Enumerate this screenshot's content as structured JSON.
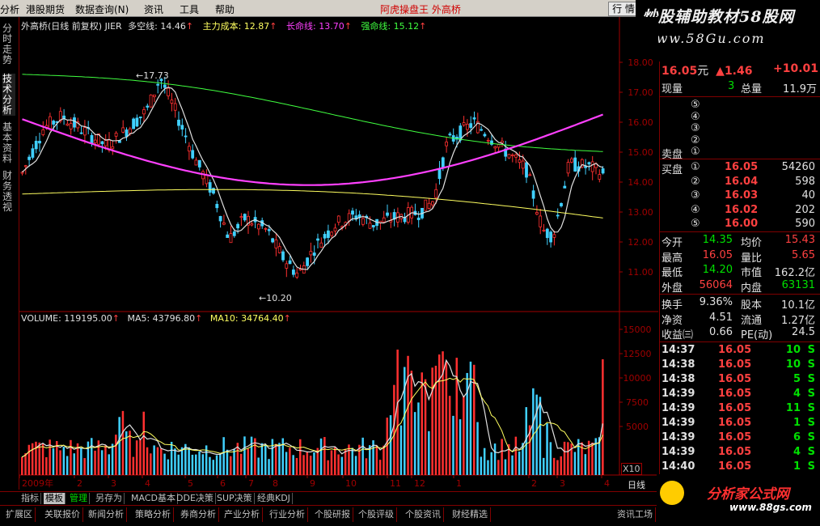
{
  "menu": {
    "items": [
      "分析",
      "港股期货",
      "数据查询(N)",
      "资讯",
      "工具",
      "帮助"
    ],
    "app_title": "阿虎操盘王  外高桥",
    "quote_button": "行 情"
  },
  "branding": {
    "top_name": "炒股辅助教材58股网",
    "top_url": "www.58Gu.com",
    "bottom_name": "分析家公式网",
    "bottom_url": "www.88gs.com"
  },
  "side_tabs": [
    "分时走势",
    "技术分析",
    "基本资料",
    "财务透视"
  ],
  "chart": {
    "header_name": "外高桥(日线 前复权) JIER",
    "indicators": [
      {
        "label": "多空线: 14.46",
        "color": "#e0e0e0"
      },
      {
        "label": "主力成本: 12.87",
        "color": "#ffff60"
      },
      {
        "label": "长命线: 13.70",
        "color": "#ff40ff"
      },
      {
        "label": "强命线: 15.12",
        "color": "#40ff40"
      }
    ],
    "price_axis": [
      "18.00",
      "17.00",
      "16.00",
      "15.00",
      "14.00",
      "13.00",
      "12.00",
      "11.00"
    ],
    "high_marker": "17.73",
    "low_marker": "10.20",
    "volume_header": [
      {
        "label": "VOLUME: 119195.00",
        "color": "#e0e0e0"
      },
      {
        "label": "MA5: 43796.80",
        "color": "#e0e0e0"
      },
      {
        "label": "MA10: 34764.40",
        "color": "#ffff60"
      }
    ],
    "volume_axis": [
      "15000",
      "12500",
      "10000",
      "7500",
      "5000"
    ],
    "volume_unit": "X10",
    "x_axis": [
      "2009年",
      "2",
      "3",
      "4",
      "5",
      "6",
      "7",
      "8",
      "9",
      "10",
      "11",
      "12",
      "1",
      "2",
      "3",
      "4"
    ],
    "period": "日线"
  },
  "quote": {
    "price": "16.05",
    "unit": "元",
    "change": "▲1.46",
    "change_pct": "+10.01",
    "current_vol_label": "现量",
    "current_vol": "3",
    "total_vol_label": "总量",
    "total_vol": "11.9万",
    "sell_label": "卖盘",
    "buy_label": "买盘",
    "sell_levels": [
      "⑤",
      "④",
      "③",
      "②",
      "①"
    ],
    "buy_levels": [
      {
        "num": "①",
        "price": "16.05",
        "vol": "54260"
      },
      {
        "num": "②",
        "price": "16.04",
        "vol": "598"
      },
      {
        "num": "③",
        "price": "16.03",
        "vol": "40"
      },
      {
        "num": "④",
        "price": "16.02",
        "vol": "202"
      },
      {
        "num": "⑤",
        "price": "16.00",
        "vol": "590"
      }
    ],
    "stats1": [
      {
        "k1": "今开",
        "v1": "14.35",
        "c1": "#00e000",
        "k2": "均价",
        "v2": "15.43",
        "c2": "#ff4040"
      },
      {
        "k1": "最高",
        "v1": "16.05",
        "c1": "#ff4040",
        "k2": "量比",
        "v2": "5.65",
        "c2": "#ff4040"
      },
      {
        "k1": "最低",
        "v1": "14.20",
        "c1": "#00e000",
        "k2": "市值",
        "v2": "162.2亿",
        "c2": "#e0e0e0"
      },
      {
        "k1": "外盘",
        "v1": "56064",
        "c1": "#ff4040",
        "k2": "内盘",
        "v2": "63131",
        "c2": "#00e000"
      }
    ],
    "stats2": [
      {
        "k1": "换手",
        "v1": "9.36%",
        "k2": "股本",
        "v2": "10.1亿"
      },
      {
        "k1": "净资",
        "v1": "4.51",
        "k2": "流通",
        "v2": "1.27亿"
      },
      {
        "k1": "收益㈢",
        "v1": "0.66",
        "k2": "PE(动)",
        "v2": "24.5"
      }
    ],
    "ticks": [
      {
        "t": "14:37",
        "p": "16.05",
        "v": "10",
        "s": "S"
      },
      {
        "t": "14:38",
        "p": "16.05",
        "v": "10",
        "s": "S"
      },
      {
        "t": "14:38",
        "p": "16.05",
        "v": "5",
        "s": "S"
      },
      {
        "t": "14:39",
        "p": "16.05",
        "v": "4",
        "s": "S"
      },
      {
        "t": "14:39",
        "p": "16.05",
        "v": "11",
        "s": "S"
      },
      {
        "t": "14:39",
        "p": "16.05",
        "v": "1",
        "s": "S"
      },
      {
        "t": "14:39",
        "p": "16.05",
        "v": "6",
        "s": "S"
      },
      {
        "t": "14:39",
        "p": "16.05",
        "v": "4",
        "s": "S"
      },
      {
        "t": "14:40",
        "p": "16.05",
        "v": "1",
        "s": "S"
      },
      {
        "t": "14:40",
        "p": "16.05",
        "v": "3",
        "s": "S"
      }
    ]
  },
  "tabs": [
    "指标",
    "模板",
    "管理",
    "另存为",
    "MACD基本",
    "DDE决策",
    "SUP决策",
    "经典KDJ"
  ],
  "func_bar": [
    "扩展区",
    "关联报价",
    "新闻分析",
    "策略分析",
    "券商分析",
    "产业分析",
    "行业分析",
    "个股研报",
    "个股评级",
    "个股资讯",
    "财经精选",
    "资讯工场"
  ]
}
